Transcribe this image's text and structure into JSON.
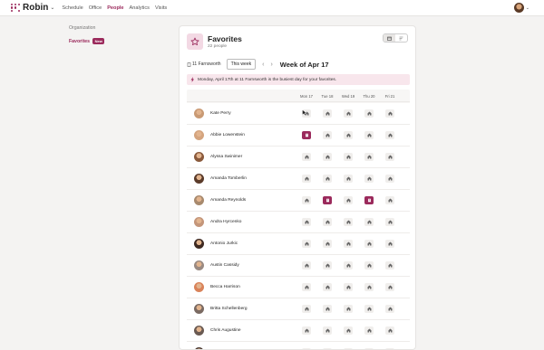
{
  "brand": {
    "name": "Robin",
    "color": "#9b2a5c"
  },
  "nav": {
    "items": [
      "Schedule",
      "Office",
      "People",
      "Analytics",
      "Visits"
    ],
    "active": "People"
  },
  "sidebar": {
    "organization": "Organization",
    "favorites": "Favorites",
    "new_badge": "New"
  },
  "header": {
    "title": "Favorites",
    "count": "22 people"
  },
  "filters": {
    "location": "11 Farnsworth",
    "this_week": "This week",
    "week_label": "Week of Apr 17"
  },
  "banner": {
    "text": "Monday, April 17th at 11 Farnsworth is the busiest day for your favorites."
  },
  "days": [
    "Mon 17",
    "Tue 18",
    "Wed 19",
    "Thu 20",
    "Fri 21"
  ],
  "people": [
    {
      "name": "Kate Perry",
      "status": [
        "home",
        "home",
        "home",
        "home",
        "home"
      ]
    },
    {
      "name": "Abbie Lowenstein",
      "status": [
        "office",
        "home",
        "home",
        "home",
        "home"
      ]
    },
    {
      "name": "Alyssa Swinimer",
      "status": [
        "home",
        "home",
        "home",
        "home",
        "home"
      ]
    },
    {
      "name": "Amanda Tomberlin",
      "status": [
        "home",
        "home",
        "home",
        "home",
        "home"
      ]
    },
    {
      "name": "Amanda Reynolds",
      "status": [
        "home",
        "office",
        "home",
        "office",
        "home"
      ]
    },
    {
      "name": "Andra Hyrcenko",
      "status": [
        "home",
        "home",
        "home",
        "home",
        "home"
      ]
    },
    {
      "name": "Antonio Jurkic",
      "status": [
        "home",
        "home",
        "home",
        "home",
        "home"
      ]
    },
    {
      "name": "Austin Cassidy",
      "status": [
        "home",
        "home",
        "home",
        "home",
        "home"
      ]
    },
    {
      "name": "Becca Harrison",
      "status": [
        "home",
        "home",
        "home",
        "home",
        "home"
      ]
    },
    {
      "name": "Britta Schellenberg",
      "status": [
        "home",
        "home",
        "home",
        "home",
        "home"
      ]
    },
    {
      "name": "Chris Augustine",
      "status": [
        "home",
        "home",
        "home",
        "home",
        "home"
      ]
    },
    {
      "name": "",
      "status": [
        "home",
        "home",
        "home",
        "home",
        "home"
      ]
    }
  ]
}
